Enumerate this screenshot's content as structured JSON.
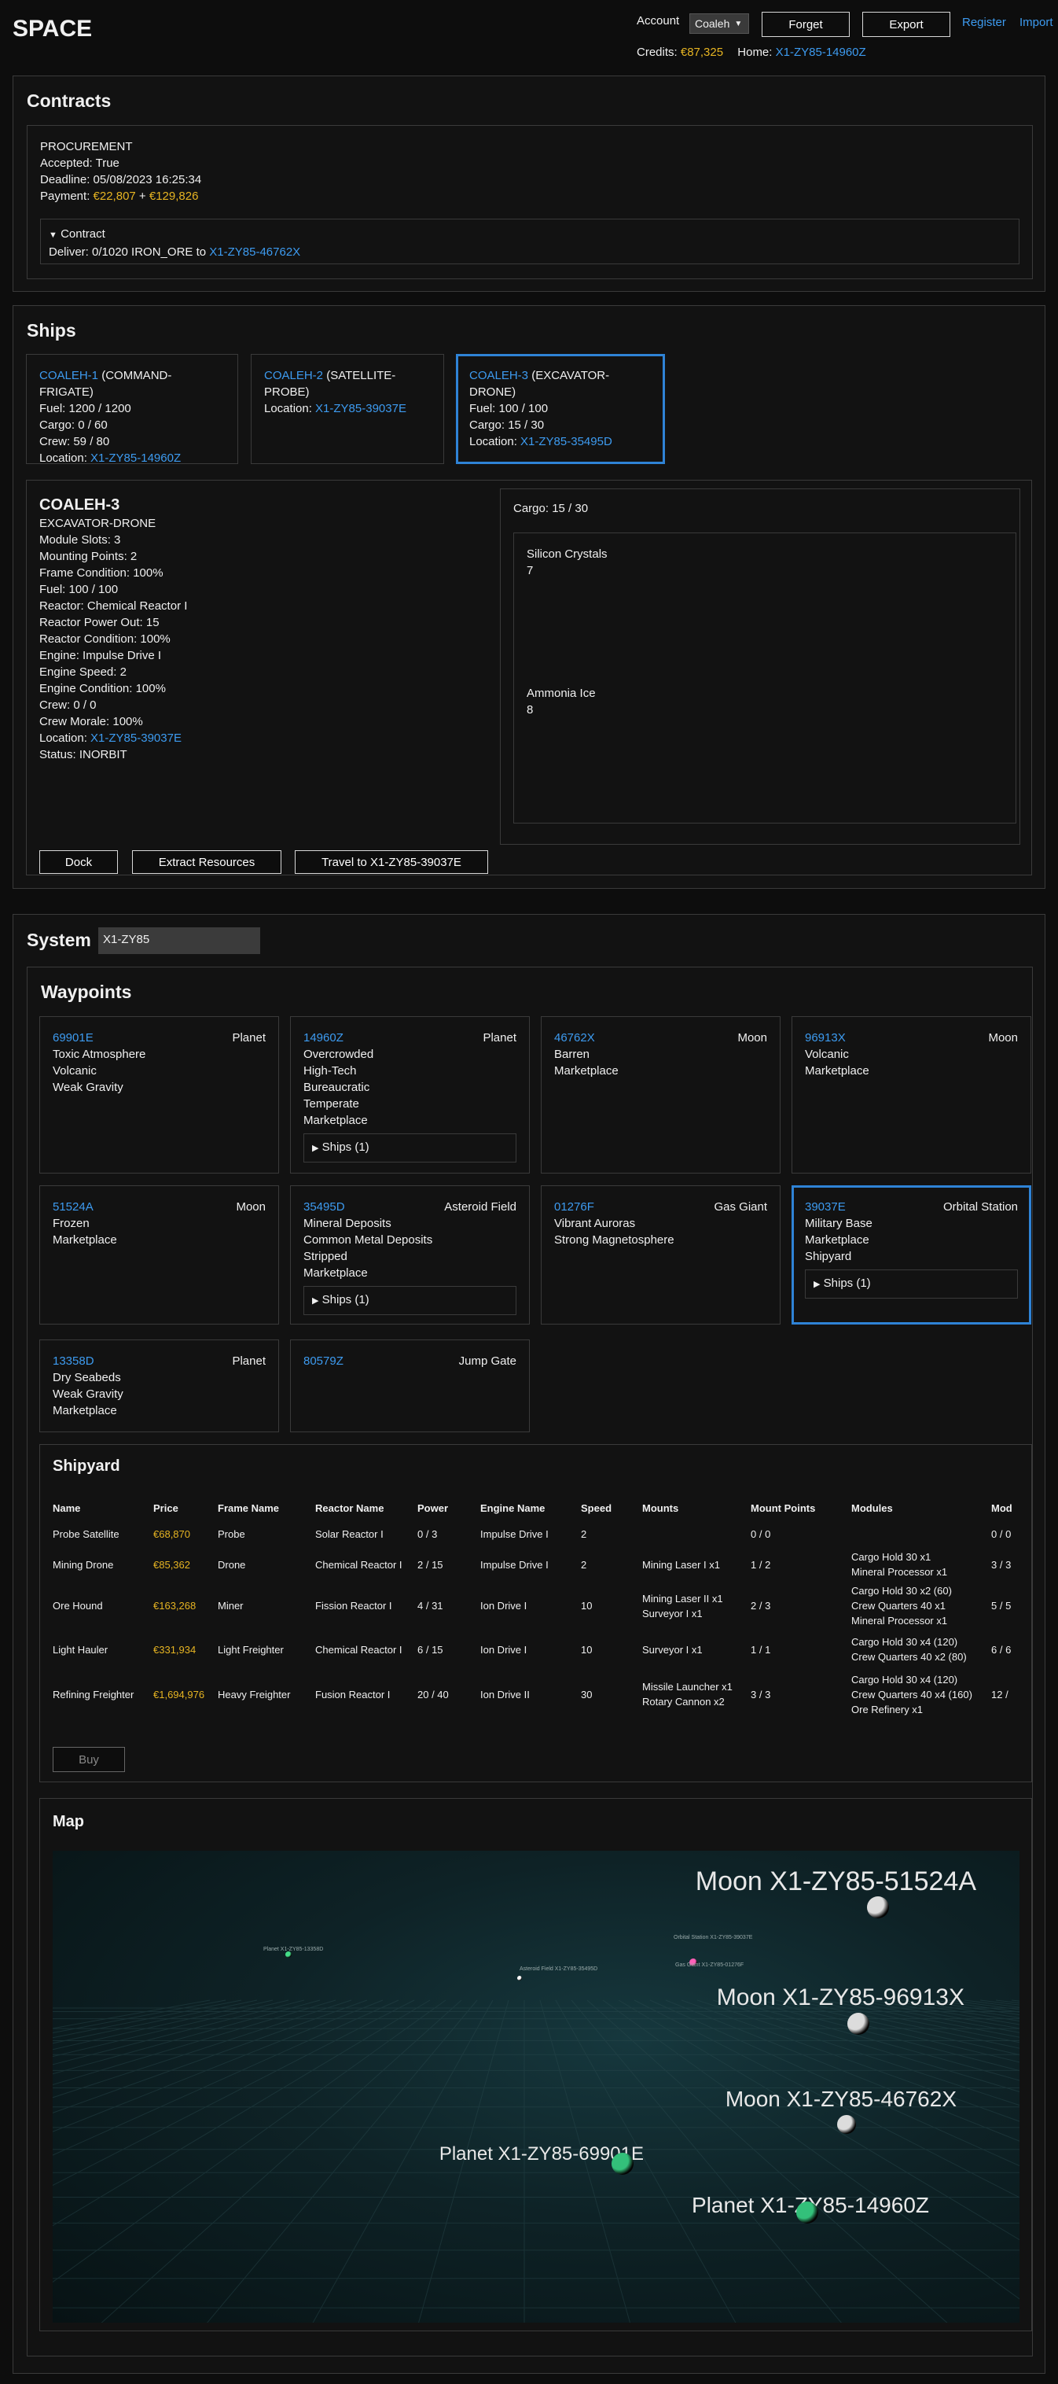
{
  "header": {
    "logo": "SPACE",
    "account_label": "Account",
    "account_value": "Coaleh",
    "forget": "Forget",
    "export": "Export",
    "register": "Register",
    "import": "Import",
    "credits_label": "Credits: ",
    "credits_value": "€87,325",
    "home_label": "Home: ",
    "home_value": "X1-ZY85-14960Z"
  },
  "contracts": {
    "title": "Contracts",
    "type": "PROCUREMENT",
    "accepted": "Accepted: True",
    "deadline": "Deadline: 05/08/2023 16:25:34",
    "payment_label": "Payment: ",
    "payment_a": "€22,807",
    "payment_plus": " + ",
    "payment_b": "€129,826",
    "details_summary": "Contract",
    "deliver_text": "Deliver: 0/1020 IRON_ORE to ",
    "deliver_dest": "X1-ZY85-46762X"
  },
  "ships": {
    "title": "Ships",
    "cards": [
      {
        "name": "COALEH-1",
        "role": " (COMMAND-FRIGATE)",
        "lines": [
          "Fuel: 1200 / 1200",
          "Cargo: 0 / 60",
          "Crew: 59 / 80"
        ],
        "loc_label": "Location: ",
        "loc": "X1-ZY85-14960Z"
      },
      {
        "name": "COALEH-2",
        "role": " (SATELLITE-PROBE)",
        "loc_label": "Location: ",
        "loc": "X1-ZY85-39037E"
      },
      {
        "name": "COALEH-3",
        "role": " (EXCAVATOR-DRONE)",
        "lines": [
          "Fuel: 100 / 100",
          "Cargo: 15 / 30"
        ],
        "loc_label": "Location: ",
        "loc": "X1-ZY85-35495D"
      }
    ],
    "detail": {
      "name": "COALEH-3",
      "lines": [
        "EXCAVATOR-DRONE",
        "Module Slots: 3",
        "Mounting Points: 2",
        "Frame Condition: 100%",
        "Fuel: 100 / 100",
        "Reactor: Chemical Reactor I",
        "Reactor Power Out: 15",
        "Reactor Condition: 100%",
        "Engine: Impulse Drive I",
        "Engine Speed: 2",
        "Engine Condition: 100%",
        "Crew: 0 / 0",
        "Crew Morale: 100%"
      ],
      "loc_label": "Location: ",
      "loc": "X1-ZY85-39037E",
      "status": "Status: INORBIT",
      "cargo_title": "Cargo: 15 / 30",
      "cargo": [
        {
          "name": "Silicon Crystals",
          "qty": "7"
        },
        {
          "name": "Ammonia Ice",
          "qty": "8"
        }
      ],
      "buttons": {
        "dock": "Dock",
        "extract": "Extract Resources",
        "travel": "Travel to X1-ZY85-39037E"
      }
    }
  },
  "system": {
    "title": "System",
    "input_value": "X1-ZY85",
    "waypoints_title": "Waypoints",
    "waypoints": [
      {
        "id": "69901E",
        "type": "Planet",
        "traits": [
          "Toxic Atmosphere",
          "Volcanic",
          "Weak Gravity"
        ]
      },
      {
        "id": "14960Z",
        "type": "Planet",
        "traits": [
          "Overcrowded",
          "High-Tech",
          "Bureaucratic",
          "Temperate",
          "Marketplace"
        ],
        "ships": "Ships (1)"
      },
      {
        "id": "46762X",
        "type": "Moon",
        "traits": [
          "Barren",
          "Marketplace"
        ]
      },
      {
        "id": "96913X",
        "type": "Moon",
        "traits": [
          "Volcanic",
          "Marketplace"
        ]
      },
      {
        "id": "51524A",
        "type": "Moon",
        "traits": [
          "Frozen",
          "Marketplace"
        ]
      },
      {
        "id": "35495D",
        "type": "Asteroid Field",
        "traits": [
          "Mineral Deposits",
          "Common Metal Deposits",
          "Stripped",
          "Marketplace"
        ],
        "ships": "Ships (1)"
      },
      {
        "id": "01276F",
        "type": "Gas Giant",
        "traits": [
          "Vibrant Auroras",
          "Strong Magnetosphere"
        ]
      },
      {
        "id": "39037E",
        "type": "Orbital Station",
        "traits": [
          "Military Base",
          "Marketplace",
          "Shipyard"
        ],
        "ships": "Ships (1)"
      },
      {
        "id": "13358D",
        "type": "Planet",
        "traits": [
          "Dry Seabeds",
          "Weak Gravity",
          "Marketplace"
        ]
      },
      {
        "id": "80579Z",
        "type": "Jump Gate",
        "traits": []
      }
    ],
    "shipyard": {
      "title": "Shipyard",
      "columns": [
        "Name",
        "Price",
        "Frame Name",
        "Reactor Name",
        "Power",
        "Engine Name",
        "Speed",
        "Mounts",
        "Mount Points",
        "Modules",
        "Mod"
      ],
      "rows": [
        {
          "name": "Probe Satellite",
          "price": "€68,870",
          "frame": "Probe",
          "reactor": "Solar Reactor I",
          "power": "0 / 3",
          "engine": "Impulse Drive I",
          "speed": "2",
          "mounts": [],
          "mount_points": "0 / 0",
          "modules": [],
          "mod": "0 / 0"
        },
        {
          "name": "Mining Drone",
          "price": "€85,362",
          "frame": "Drone",
          "reactor": "Chemical Reactor I",
          "power": "2 / 15",
          "engine": "Impulse Drive I",
          "speed": "2",
          "mounts": [
            "Mining Laser I x1"
          ],
          "mount_points": "1 / 2",
          "modules": [
            "Cargo Hold 30 x1",
            "Mineral Processor x1"
          ],
          "mod": "3 / 3"
        },
        {
          "name": "Ore Hound",
          "price": "€163,268",
          "frame": "Miner",
          "reactor": "Fission Reactor I",
          "power": "4 / 31",
          "engine": "Ion Drive I",
          "speed": "10",
          "mounts": [
            "Mining Laser II x1",
            "Surveyor I x1"
          ],
          "mount_points": "2 / 3",
          "modules": [
            "Cargo Hold 30 x2 (60)",
            "Crew Quarters 40 x1",
            "Mineral Processor x1"
          ],
          "mod": "5 / 5"
        },
        {
          "name": "Light Hauler",
          "price": "€331,934",
          "frame": "Light Freighter",
          "reactor": "Chemical Reactor I",
          "power": "6 / 15",
          "engine": "Ion Drive I",
          "speed": "10",
          "mounts": [
            "Surveyor I x1"
          ],
          "mount_points": "1 / 1",
          "modules": [
            "Cargo Hold 30 x4 (120)",
            "Crew Quarters 40 x2 (80)"
          ],
          "mod": "6 / 6"
        },
        {
          "name": "Refining Freighter",
          "price": "€1,694,976",
          "frame": "Heavy Freighter",
          "reactor": "Fusion Reactor I",
          "power": "20 / 40",
          "engine": "Ion Drive II",
          "speed": "30",
          "mounts": [
            "Missile Launcher x1",
            "Rotary Cannon x2"
          ],
          "mount_points": "3 / 3",
          "modules": [
            "Cargo Hold 30 x4 (120)",
            "Crew Quarters 40 x4 (160)",
            "Ore Refinery x1"
          ],
          "mod": "12 /"
        }
      ],
      "buy": "Buy"
    },
    "map": {
      "title": "Map",
      "labels": [
        {
          "text": "Moon X1-ZY85-51524A",
          "size": "big"
        },
        {
          "text": "Moon X1-ZY85-96913X",
          "size": "big"
        },
        {
          "text": "Moon X1-ZY85-46762X",
          "size": "big"
        },
        {
          "text": "Planet X1-ZY85-69901E",
          "size": "mid"
        },
        {
          "text": "Planet X1-ZY85-14960Z",
          "size": "big"
        },
        {
          "text": "Asteroid Field X1-ZY85-35495D",
          "size": "tiny"
        },
        {
          "text": "Orbital Station X1-ZY85-39037E",
          "size": "tiny"
        },
        {
          "text": "Gas Giant X1-ZY85-01276F",
          "size": "tiny"
        },
        {
          "text": "Planet X1-ZY85-13358D",
          "size": "tiny"
        }
      ]
    }
  }
}
